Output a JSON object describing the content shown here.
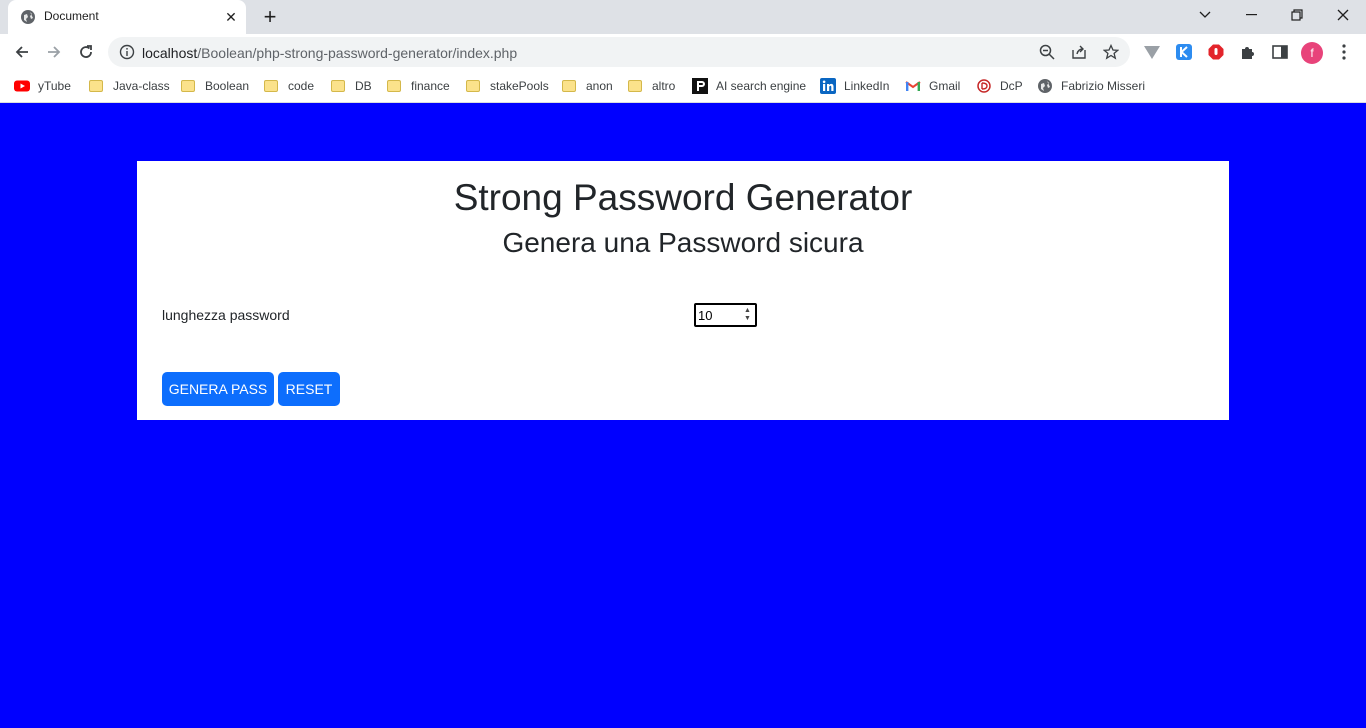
{
  "browser": {
    "tab_title": "Document",
    "tab_close": "✕",
    "new_tab": "+",
    "url_host": "localhost",
    "url_path": "/Boolean/php-strong-password-generator/index.php",
    "profile_initial": "f"
  },
  "bookmarks": [
    {
      "label": "yTube",
      "icon": "youtube-icon"
    },
    {
      "label": "Java-class",
      "icon": "folder-icon"
    },
    {
      "label": "Boolean",
      "icon": "folder-icon"
    },
    {
      "label": "code",
      "icon": "folder-icon"
    },
    {
      "label": "DB",
      "icon": "folder-icon"
    },
    {
      "label": "finance",
      "icon": "folder-icon"
    },
    {
      "label": "stakePools",
      "icon": "folder-icon"
    },
    {
      "label": "anon",
      "icon": "folder-icon"
    },
    {
      "label": "altro",
      "icon": "folder-icon"
    },
    {
      "label": "AI search engine",
      "icon": "perplexity-icon"
    },
    {
      "label": "LinkedIn",
      "icon": "linkedin-icon"
    },
    {
      "label": "Gmail",
      "icon": "gmail-icon"
    },
    {
      "label": "DcP",
      "icon": "dcp-icon"
    },
    {
      "label": "Fabrizio Misseri",
      "icon": "globe-icon"
    }
  ],
  "page": {
    "title": "Strong Password Generator",
    "subtitle": "Genera una Password sicura",
    "length_label": "lunghezza password",
    "length_value": "10",
    "generate_button": "GENERA PASS",
    "reset_button": "RESET"
  },
  "colors": {
    "page_background": "#0000ff",
    "button_primary": "#0d6efd"
  }
}
